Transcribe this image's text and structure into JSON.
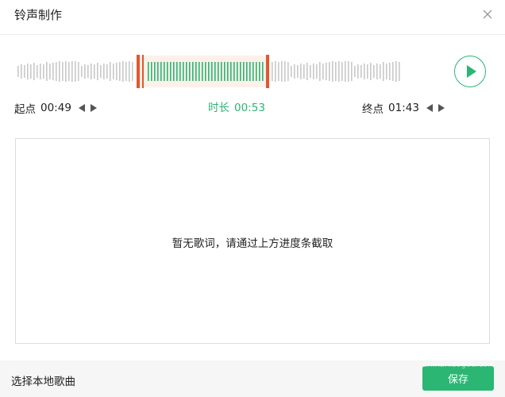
{
  "window": {
    "title": "铃声制作"
  },
  "icons": {
    "close": "close-icon",
    "play": "play-icon",
    "left": "left-arrow-icon",
    "right": "right-arrow-icon"
  },
  "colors": {
    "accent": "#2bb673",
    "marker": "#e5552f",
    "selection_bg": "#fdf1ea",
    "wave_inactive": "#c8c8c8"
  },
  "trim": {
    "start_label": "起点",
    "start_time": "00:49",
    "duration_label": "时长",
    "duration_time": "00:53",
    "end_label": "终点",
    "end_time": "01:43"
  },
  "lyrics": {
    "empty_message": "暂无歌词，请通过上方进度条截取"
  },
  "footer": {
    "local_song_label": "选择本地歌曲",
    "save_label": "保存"
  },
  "watermark": {
    "text": "zhinan.sogou.com"
  }
}
